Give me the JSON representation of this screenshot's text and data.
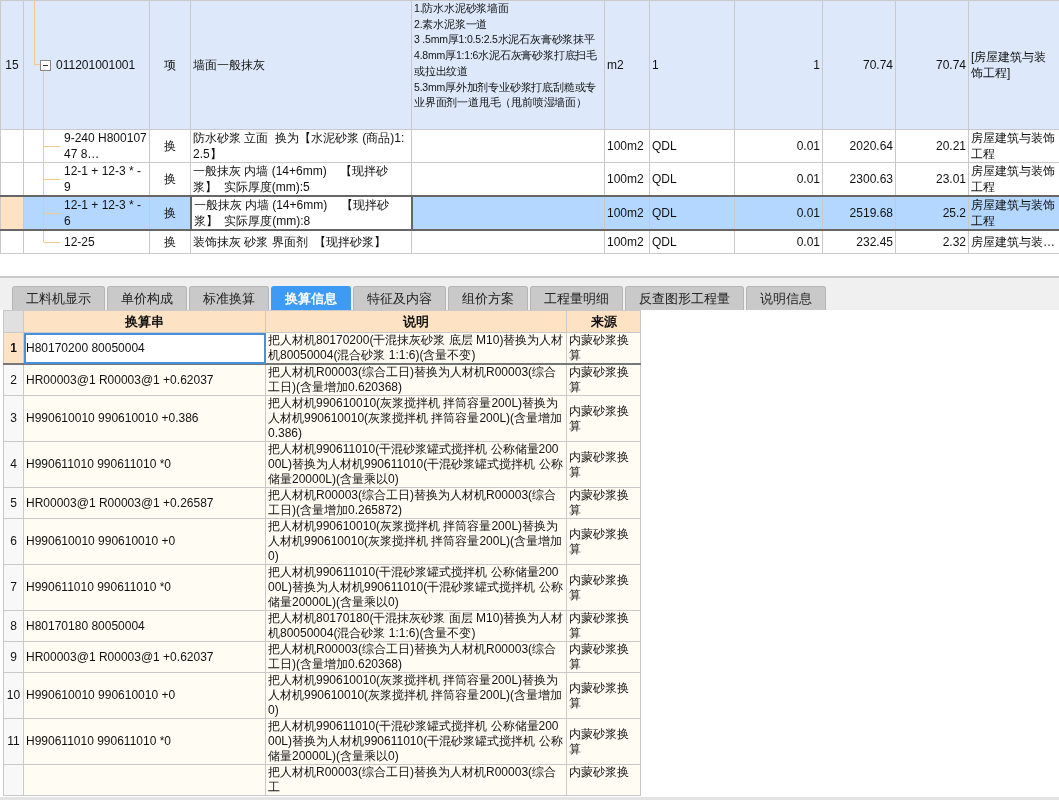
{
  "top_table": {
    "rows": [
      {
        "column_1": "15",
        "column_2": "011201001001",
        "column_3": "项",
        "column_4": "墙面一般抹灰",
        "column_5": "1.防水水泥砂浆墙面\n2.素水泥浆一道\n3 .5mm厚1:0.5:2.5水泥石灰膏砂浆抹平\n4.8mm厚1:1:6水泥石灰膏砂浆打底扫毛或拉出纹道\n5.3mm厚外加剂专业砂浆打底刮糙或专业界面剂一道甩毛（甩前喷湿墙面）",
        "column_6": "m2",
        "column_7": "1",
        "column_8": "1",
        "column_9": "70.74",
        "column_10": "70.74",
        "column_11": "[房屋建筑与装饰工程]",
        "expanded": true,
        "selected": false,
        "children": [
          {
            "column_2": "9-240 H80010747 8…",
            "column_3": "换",
            "column_4": "防水砂浆 立面  换为【水泥砂浆 (商品)1:2.5】",
            "column_6": "100m2",
            "column_7": "QDL",
            "column_8": "0.01",
            "column_9": "2020.64",
            "column_10": "20.21",
            "column_11": "房屋建筑与装饰工程",
            "selected": false
          },
          {
            "column_2": "12-1 + 12-3 * -9",
            "column_3": "换",
            "column_4": "一般抹灰 内墙 (14+6mm)    【现拌砂浆】  实际厚度(mm):5",
            "column_6": "100m2",
            "column_7": "QDL",
            "column_8": "0.01",
            "column_9": "2300.63",
            "column_10": "23.01",
            "column_11": "房屋建筑与装饰工程",
            "selected": false
          },
          {
            "column_2": "12-1 + 12-3 * -6",
            "column_3": "换",
            "column_4": "一般抹灰 内墙 (14+6mm)    【现拌砂浆】  实际厚度(mm):8",
            "column_6": "100m2",
            "column_7": "QDL",
            "column_8": "0.01",
            "column_9": "2519.68",
            "column_10": "25.2",
            "column_11": "房屋建筑与装饰工程",
            "selected": true
          },
          {
            "column_2": "12-25",
            "column_3": "换",
            "column_4": "装饰抹灰 砂浆 界面剂  【现拌砂浆】",
            "column_6": "100m2",
            "column_7": "QDL",
            "column_8": "0.01",
            "column_9": "232.45",
            "column_10": "2.32",
            "column_11": "房屋建筑与装…",
            "selected": false
          }
        ]
      }
    ]
  },
  "tabs": [
    {
      "label": "工料机显示",
      "selected": false
    },
    {
      "label": "单价构成",
      "selected": false
    },
    {
      "label": "标准换算",
      "selected": false
    },
    {
      "label": "换算信息",
      "selected": true
    },
    {
      "label": "特征及内容",
      "selected": false
    },
    {
      "label": "组价方案",
      "selected": false
    },
    {
      "label": "工程量明细",
      "selected": false
    },
    {
      "label": "反查图形工程量",
      "selected": false
    },
    {
      "label": "说明信息",
      "selected": false
    }
  ],
  "detail_table": {
    "columns": [
      "换算串",
      "说明",
      "来源"
    ],
    "rows": [
      {
        "number": "1",
        "code": "H80170200 80050004",
        "description": "把人材机80170200(干混抹灰砂浆 底层 M10)替换为人材机80050004(混合砂浆 1:1:6)(含量不变)",
        "source": "内蒙砂浆换算",
        "selected": true
      },
      {
        "number": "2",
        "code": "HR00003@1 R00003@1 +0.62037",
        "description": "把人材机R00003(综合工日)替换为人材机R00003(综合工日)(含量增加0.620368)",
        "source": "内蒙砂浆换算",
        "selected": false
      },
      {
        "number": "3",
        "code": "H990610010 990610010 +0.386",
        "description": "把人材机990610010(灰浆搅拌机 拌筒容量200L)替换为人材机990610010(灰浆搅拌机 拌筒容量200L)(含量增加0.386)",
        "source": "内蒙砂浆换算",
        "selected": false
      },
      {
        "number": "4",
        "code": "H990611010 990611010 *0",
        "description": "把人材机990611010(干混砂浆罐式搅拌机 公称储量20000L)替换为人材机990611010(干混砂浆罐式搅拌机 公称储量20000L)(含量乘以0)",
        "source": "内蒙砂浆换算",
        "selected": false
      },
      {
        "number": "5",
        "code": "HR00003@1 R00003@1 +0.26587",
        "description": "把人材机R00003(综合工日)替换为人材机R00003(综合工日)(含量增加0.265872)",
        "source": "内蒙砂浆换算",
        "selected": false
      },
      {
        "number": "6",
        "code": "H990610010 990610010 +0",
        "description": "把人材机990610010(灰浆搅拌机 拌筒容量200L)替换为人材机990610010(灰浆搅拌机 拌筒容量200L)(含量增加0)",
        "source": "内蒙砂浆换算",
        "selected": false
      },
      {
        "number": "7",
        "code": "H990611010 990611010 *0",
        "description": "把人材机990611010(干混砂浆罐式搅拌机 公称储量20000L)替换为人材机990611010(干混砂浆罐式搅拌机 公称储量20000L)(含量乘以0)",
        "source": "内蒙砂浆换算",
        "selected": false
      },
      {
        "number": "8",
        "code": "H80170180 80050004",
        "description": "把人材机80170180(干混抹灰砂浆 面层 M10)替换为人材机80050004(混合砂浆 1:1:6)(含量不变)",
        "source": "内蒙砂浆换算",
        "selected": false
      },
      {
        "number": "9",
        "code": "HR00003@1 R00003@1 +0.62037",
        "description": "把人材机R00003(综合工日)替换为人材机R00003(综合工日)(含量增加0.620368)",
        "source": "内蒙砂浆换算",
        "selected": false
      },
      {
        "number": "10",
        "code": "H990610010 990610010 +0",
        "description": "把人材机990610010(灰浆搅拌机 拌筒容量200L)替换为人材机990610010(灰浆搅拌机 拌筒容量200L)(含量增加0)",
        "source": "内蒙砂浆换算",
        "selected": false
      },
      {
        "number": "11",
        "code": "H990611010 990611010 *0",
        "description": "把人材机990611010(干混砂浆罐式搅拌机 公称储量20000L)替换为人材机990611010(干混砂浆罐式搅拌机 公称储量20000L)(含量乘以0)",
        "source": "内蒙砂浆换算",
        "selected": false
      },
      {
        "description": "把人材机R00003(综合工日)替换为人材机R00003(综合工",
        "source": "内蒙砂浆换",
        "selected": false
      }
    ]
  }
}
